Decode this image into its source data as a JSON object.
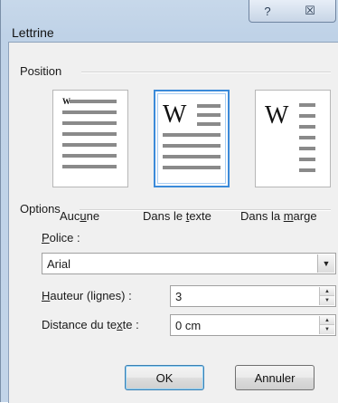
{
  "window": {
    "title": "Lettrine",
    "help_glyph": "?",
    "close_glyph": "☒"
  },
  "position": {
    "label": "Position",
    "options": [
      {
        "label_pre": "Auc",
        "label_u": "u",
        "label_post": "ne",
        "selected": false
      },
      {
        "label_pre": "Dans le ",
        "label_u": "t",
        "label_post": "exte",
        "selected": true
      },
      {
        "label_pre": "Dans la ",
        "label_u": "m",
        "label_post": "arge",
        "selected": false
      }
    ],
    "drop_letter": "W"
  },
  "options": {
    "label": "Options",
    "font": {
      "label_u": "P",
      "label_rest": "olice :",
      "value": "Arial"
    },
    "height": {
      "label_u": "H",
      "label_rest": "auteur (lignes) :",
      "value": "3"
    },
    "distance": {
      "label_pre": "Distance du te",
      "label_u": "x",
      "label_post": "te :",
      "value": "0 cm"
    }
  },
  "buttons": {
    "ok": "OK",
    "cancel": "Annuler"
  },
  "icons": {
    "dropdown": "arrow-down-icon",
    "spin_up": "arrow-up-icon",
    "spin_down": "arrow-down-icon"
  },
  "colors": {
    "accent": "#3b8ad9",
    "chrome": "#c2d4e8",
    "face": "#f0f0f0"
  }
}
